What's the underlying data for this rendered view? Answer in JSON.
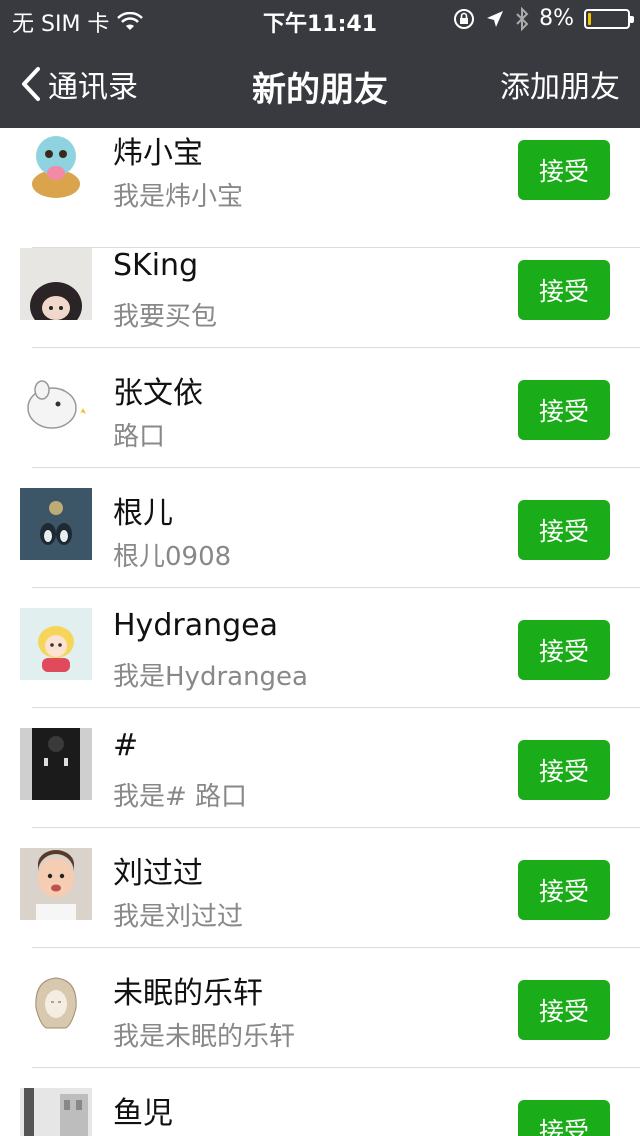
{
  "status_bar": {
    "carrier": "无 SIM 卡",
    "time": "下午11:41",
    "battery_percent": "8%",
    "battery_level": 0.08
  },
  "navbar": {
    "back_label": "通讯录",
    "title": "新的朋友",
    "action_label": "添加朋友"
  },
  "friends": [
    {
      "name": "炜小宝",
      "message": "我是炜小宝",
      "button": "接受",
      "avatar": "squirtle-icon"
    },
    {
      "name": "SKing",
      "message": "我要买包",
      "button": "接受",
      "avatar": "girl-photo"
    },
    {
      "name": "张文依",
      "message": "路口",
      "button": "接受",
      "avatar": "chinchilla-icon"
    },
    {
      "name": "根儿",
      "message": "根儿0908",
      "button": "接受",
      "avatar": "penguins-icon"
    },
    {
      "name": "Hydrangea",
      "message": "我是Hydrangea",
      "button": "接受",
      "avatar": "anime-girl-icon"
    },
    {
      "name": "#",
      "message": "我是# 路口",
      "button": "接受",
      "avatar": "dark-figure-photo"
    },
    {
      "name": "刘过过",
      "message": "我是刘过过",
      "button": "接受",
      "avatar": "baby-photo"
    },
    {
      "name": "未眠的乐轩",
      "message": "我是未眠的乐轩",
      "button": "接受",
      "avatar": "sketch-girl-icon"
    },
    {
      "name": "鱼児",
      "message": "",
      "button": "接受",
      "avatar": "street-photo"
    }
  ],
  "colors": {
    "navbar_bg": "#393a3f",
    "accept_button": "#1aad19",
    "battery": "#f2c500"
  }
}
